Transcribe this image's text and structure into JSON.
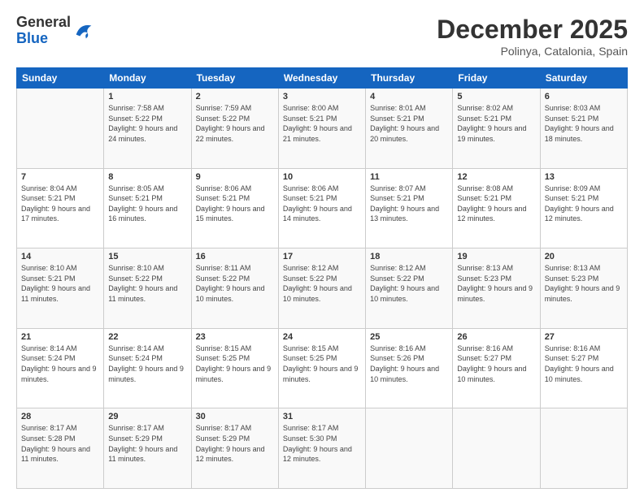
{
  "logo": {
    "general": "General",
    "blue": "Blue"
  },
  "title": {
    "month": "December 2025",
    "location": "Polinya, Catalonia, Spain"
  },
  "weekdays": [
    "Sunday",
    "Monday",
    "Tuesday",
    "Wednesday",
    "Thursday",
    "Friday",
    "Saturday"
  ],
  "weeks": [
    [
      {
        "day": "",
        "sunrise": "",
        "sunset": "",
        "daylight": ""
      },
      {
        "day": "1",
        "sunrise": "Sunrise: 7:58 AM",
        "sunset": "Sunset: 5:22 PM",
        "daylight": "Daylight: 9 hours and 24 minutes."
      },
      {
        "day": "2",
        "sunrise": "Sunrise: 7:59 AM",
        "sunset": "Sunset: 5:22 PM",
        "daylight": "Daylight: 9 hours and 22 minutes."
      },
      {
        "day": "3",
        "sunrise": "Sunrise: 8:00 AM",
        "sunset": "Sunset: 5:21 PM",
        "daylight": "Daylight: 9 hours and 21 minutes."
      },
      {
        "day": "4",
        "sunrise": "Sunrise: 8:01 AM",
        "sunset": "Sunset: 5:21 PM",
        "daylight": "Daylight: 9 hours and 20 minutes."
      },
      {
        "day": "5",
        "sunrise": "Sunrise: 8:02 AM",
        "sunset": "Sunset: 5:21 PM",
        "daylight": "Daylight: 9 hours and 19 minutes."
      },
      {
        "day": "6",
        "sunrise": "Sunrise: 8:03 AM",
        "sunset": "Sunset: 5:21 PM",
        "daylight": "Daylight: 9 hours and 18 minutes."
      }
    ],
    [
      {
        "day": "7",
        "sunrise": "Sunrise: 8:04 AM",
        "sunset": "Sunset: 5:21 PM",
        "daylight": "Daylight: 9 hours and 17 minutes."
      },
      {
        "day": "8",
        "sunrise": "Sunrise: 8:05 AM",
        "sunset": "Sunset: 5:21 PM",
        "daylight": "Daylight: 9 hours and 16 minutes."
      },
      {
        "day": "9",
        "sunrise": "Sunrise: 8:06 AM",
        "sunset": "Sunset: 5:21 PM",
        "daylight": "Daylight: 9 hours and 15 minutes."
      },
      {
        "day": "10",
        "sunrise": "Sunrise: 8:06 AM",
        "sunset": "Sunset: 5:21 PM",
        "daylight": "Daylight: 9 hours and 14 minutes."
      },
      {
        "day": "11",
        "sunrise": "Sunrise: 8:07 AM",
        "sunset": "Sunset: 5:21 PM",
        "daylight": "Daylight: 9 hours and 13 minutes."
      },
      {
        "day": "12",
        "sunrise": "Sunrise: 8:08 AM",
        "sunset": "Sunset: 5:21 PM",
        "daylight": "Daylight: 9 hours and 12 minutes."
      },
      {
        "day": "13",
        "sunrise": "Sunrise: 8:09 AM",
        "sunset": "Sunset: 5:21 PM",
        "daylight": "Daylight: 9 hours and 12 minutes."
      }
    ],
    [
      {
        "day": "14",
        "sunrise": "Sunrise: 8:10 AM",
        "sunset": "Sunset: 5:21 PM",
        "daylight": "Daylight: 9 hours and 11 minutes."
      },
      {
        "day": "15",
        "sunrise": "Sunrise: 8:10 AM",
        "sunset": "Sunset: 5:22 PM",
        "daylight": "Daylight: 9 hours and 11 minutes."
      },
      {
        "day": "16",
        "sunrise": "Sunrise: 8:11 AM",
        "sunset": "Sunset: 5:22 PM",
        "daylight": "Daylight: 9 hours and 10 minutes."
      },
      {
        "day": "17",
        "sunrise": "Sunrise: 8:12 AM",
        "sunset": "Sunset: 5:22 PM",
        "daylight": "Daylight: 9 hours and 10 minutes."
      },
      {
        "day": "18",
        "sunrise": "Sunrise: 8:12 AM",
        "sunset": "Sunset: 5:22 PM",
        "daylight": "Daylight: 9 hours and 10 minutes."
      },
      {
        "day": "19",
        "sunrise": "Sunrise: 8:13 AM",
        "sunset": "Sunset: 5:23 PM",
        "daylight": "Daylight: 9 hours and 9 minutes."
      },
      {
        "day": "20",
        "sunrise": "Sunrise: 8:13 AM",
        "sunset": "Sunset: 5:23 PM",
        "daylight": "Daylight: 9 hours and 9 minutes."
      }
    ],
    [
      {
        "day": "21",
        "sunrise": "Sunrise: 8:14 AM",
        "sunset": "Sunset: 5:24 PM",
        "daylight": "Daylight: 9 hours and 9 minutes."
      },
      {
        "day": "22",
        "sunrise": "Sunrise: 8:14 AM",
        "sunset": "Sunset: 5:24 PM",
        "daylight": "Daylight: 9 hours and 9 minutes."
      },
      {
        "day": "23",
        "sunrise": "Sunrise: 8:15 AM",
        "sunset": "Sunset: 5:25 PM",
        "daylight": "Daylight: 9 hours and 9 minutes."
      },
      {
        "day": "24",
        "sunrise": "Sunrise: 8:15 AM",
        "sunset": "Sunset: 5:25 PM",
        "daylight": "Daylight: 9 hours and 9 minutes."
      },
      {
        "day": "25",
        "sunrise": "Sunrise: 8:16 AM",
        "sunset": "Sunset: 5:26 PM",
        "daylight": "Daylight: 9 hours and 10 minutes."
      },
      {
        "day": "26",
        "sunrise": "Sunrise: 8:16 AM",
        "sunset": "Sunset: 5:27 PM",
        "daylight": "Daylight: 9 hours and 10 minutes."
      },
      {
        "day": "27",
        "sunrise": "Sunrise: 8:16 AM",
        "sunset": "Sunset: 5:27 PM",
        "daylight": "Daylight: 9 hours and 10 minutes."
      }
    ],
    [
      {
        "day": "28",
        "sunrise": "Sunrise: 8:17 AM",
        "sunset": "Sunset: 5:28 PM",
        "daylight": "Daylight: 9 hours and 11 minutes."
      },
      {
        "day": "29",
        "sunrise": "Sunrise: 8:17 AM",
        "sunset": "Sunset: 5:29 PM",
        "daylight": "Daylight: 9 hours and 11 minutes."
      },
      {
        "day": "30",
        "sunrise": "Sunrise: 8:17 AM",
        "sunset": "Sunset: 5:29 PM",
        "daylight": "Daylight: 9 hours and 12 minutes."
      },
      {
        "day": "31",
        "sunrise": "Sunrise: 8:17 AM",
        "sunset": "Sunset: 5:30 PM",
        "daylight": "Daylight: 9 hours and 12 minutes."
      },
      {
        "day": "",
        "sunrise": "",
        "sunset": "",
        "daylight": ""
      },
      {
        "day": "",
        "sunrise": "",
        "sunset": "",
        "daylight": ""
      },
      {
        "day": "",
        "sunrise": "",
        "sunset": "",
        "daylight": ""
      }
    ]
  ]
}
